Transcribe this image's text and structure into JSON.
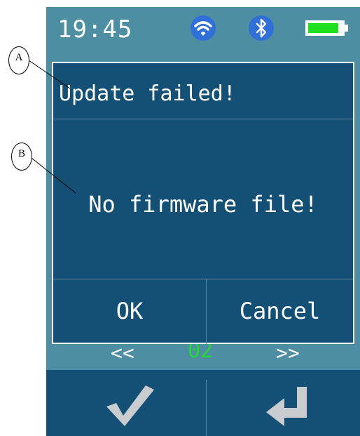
{
  "status": {
    "time": "19:45",
    "wifi_icon": "wifi-icon",
    "bluetooth_icon": "bluetooth-icon",
    "battery_level": 0.9,
    "battery_color": "#1ee01e"
  },
  "background_screen": {
    "prev_label": "<<",
    "next_label": ">>",
    "value": "02",
    "value_color": "#27d43a"
  },
  "dialog": {
    "title": "Update failed!",
    "message": "No firmware file!",
    "ok_label": "OK",
    "cancel_label": "Cancel"
  },
  "bottom_bar": {
    "confirm_icon": "checkmark-icon",
    "back_icon": "return-arrow-icon"
  },
  "callouts": {
    "a": "A",
    "b": "B"
  },
  "colors": {
    "device_background": "#4e8ea3",
    "panel": "#145075",
    "icon_blue": "#2e6fd8"
  }
}
